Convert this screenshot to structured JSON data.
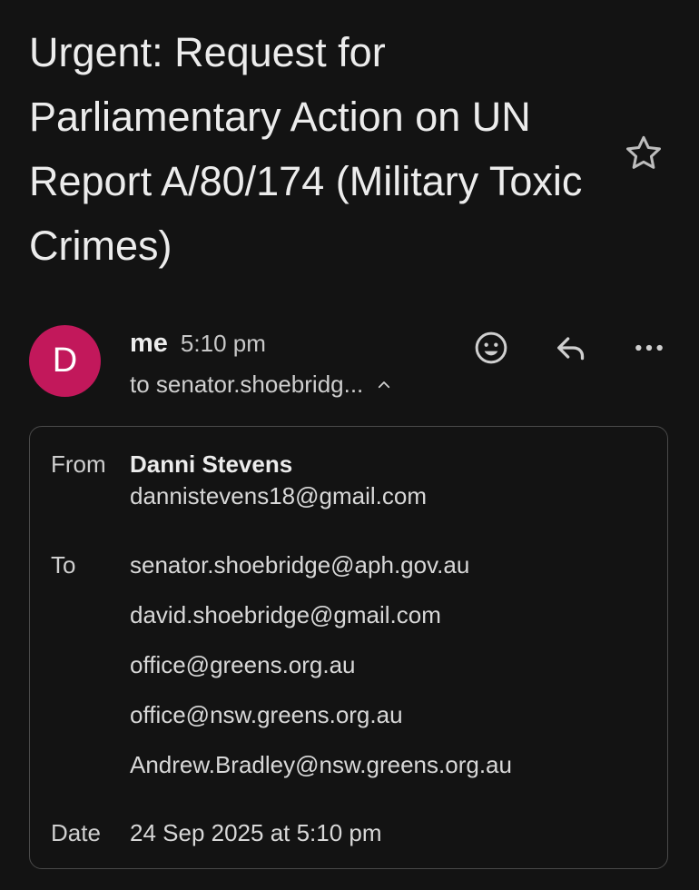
{
  "email": {
    "subject": "Urgent: Request for Parliamentary Action on UN Report A/80/174 (Military Toxic Crimes)",
    "sender": {
      "avatar_letter": "D",
      "avatar_color": "#c2185b",
      "name": "me",
      "time": "5:10 pm",
      "to_summary": "to senator.shoebridg..."
    },
    "details": {
      "from_label": "From",
      "from_name": "Danni Stevens",
      "from_email": "dannistevens18@gmail.com",
      "to_label": "To",
      "recipients": [
        "senator.shoebridge@aph.gov.au",
        "david.shoebridge@gmail.com",
        "office@greens.org.au",
        "office@nsw.greens.org.au",
        "Andrew.Bradley@nsw.greens.org.au"
      ],
      "date_label": "Date",
      "date_value": "24 Sep 2025 at 5:10 pm"
    }
  },
  "icons": {
    "star": "star-outline-icon",
    "emoji": "emoji-reaction-icon",
    "reply": "reply-icon",
    "more": "more-options-icon",
    "expand": "chevron-up-icon"
  }
}
